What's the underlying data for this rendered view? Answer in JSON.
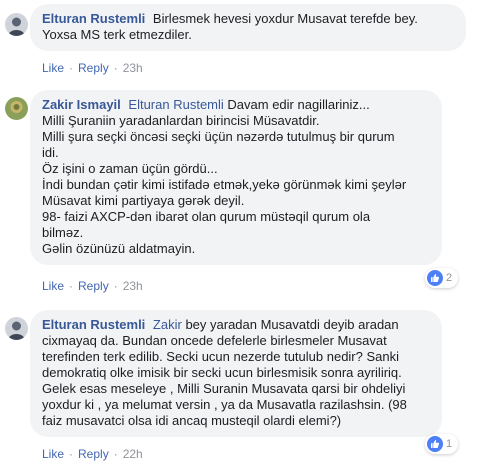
{
  "colors": {
    "link": "#385898",
    "bubble": "#f2f3f5",
    "meta": "#90949c",
    "action": "#4267b2"
  },
  "comments": [
    {
      "author": "Elturan Rustemli",
      "lines": [
        "Birlesmek hevesi yoxdur Musavat terefde bey.",
        "Yoxsa MS terk etmezdiler."
      ],
      "like": "Like",
      "reply": "Reply",
      "time": "23h"
    },
    {
      "author": "Zakir Ismayil",
      "mention": "Elturan Rustemli",
      "first_line_rest": "Davam edir nagillariniz...",
      "lines": [
        "Milli Şuraniin yaradanlardan birincisi Müsavatdir.",
        "Milli şura seçki öncəsi seçki üçün nəzərdə tutulmuş bir qurum",
        "idi.",
        "Öz işini o zaman üçün gördü...",
        "İndi bundan çətir kimi istifadə etmək,yekə görünmək kimi şeylər",
        "Müsavat kimi partiyaya gərək deyil.",
        "98- faizi AXCP-dən ibarət olan qurum müstəqil qurum ola",
        "bilməz.",
        "Gəlin özünüzü aldatmayin."
      ],
      "like": "Like",
      "reply": "Reply",
      "time": "23h",
      "reaction_count": "2"
    },
    {
      "author": "Elturan Rustemli",
      "mention": "Zakir",
      "first_line_rest": "bey yaradan Musavatdi deyib aradan",
      "lines": [
        "cixmayaq da. Bundan oncede defelerle birlesmeler Musavat",
        "terefinden terk edilib. Secki ucun nezerde tutulub nedir? Sanki",
        "demokratiq olke imisik bir secki ucun birlesmisik sonra ayriliriq.",
        "Gelek esas meseleye , Milli Suranin Musavata qarsi bir ohdeliyi",
        "yoxdur ki , ya melumat versin , ya da Musavatla razilashsin. (98",
        "faiz musavatci olsa idi ancaq musteqil olardi elemi?)"
      ],
      "like": "Like",
      "reply": "Reply",
      "time": "22h",
      "reaction_count": "1"
    }
  ]
}
